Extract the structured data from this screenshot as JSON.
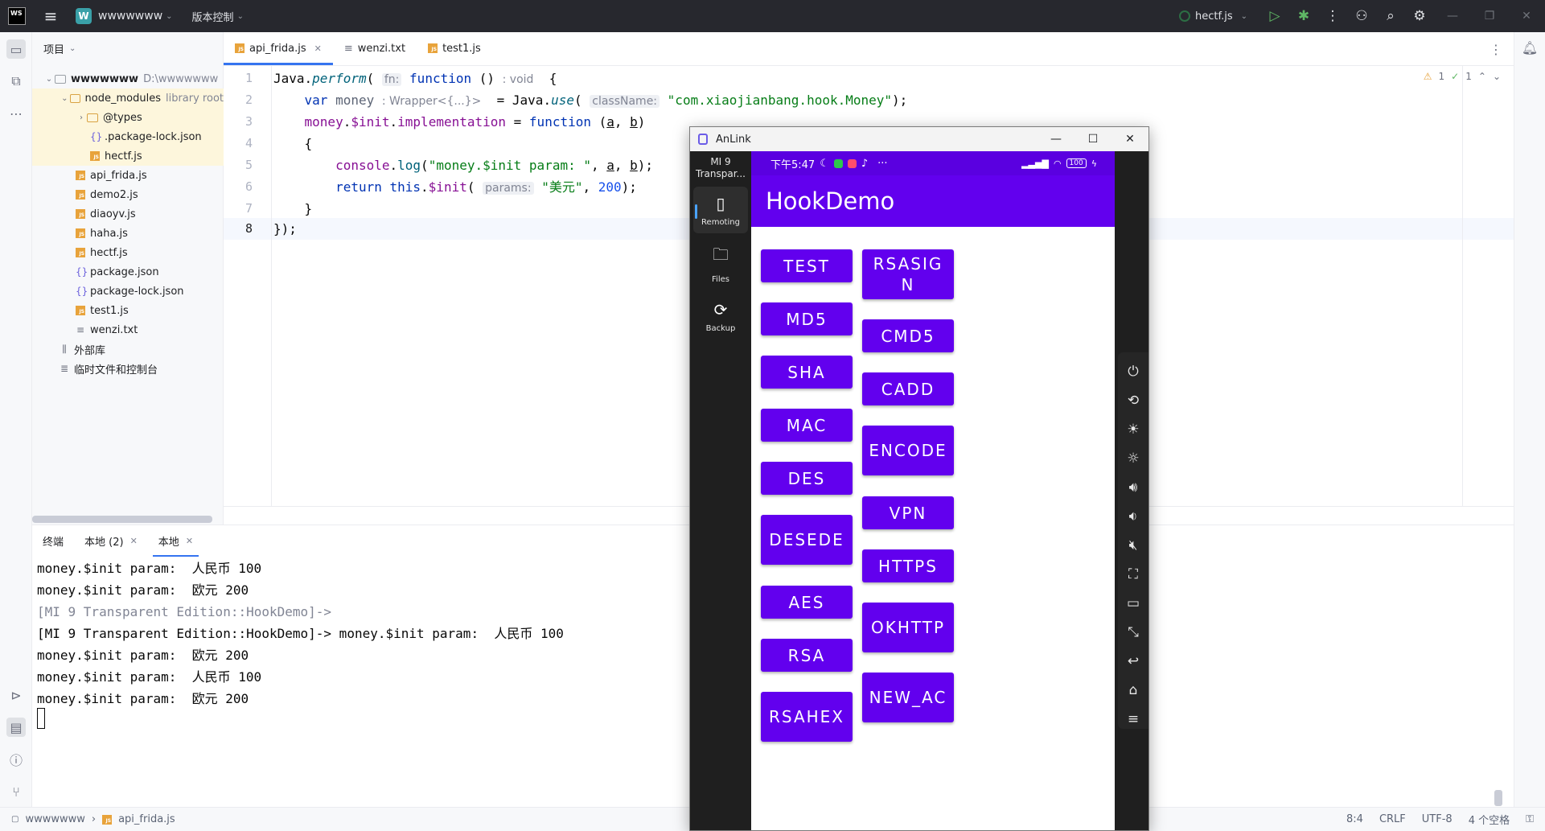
{
  "titlebar": {
    "logo": "WS",
    "project_badge": "W",
    "project_name": "wwwwwww",
    "vcs_label": "版本控制",
    "run_config": "hectf.js"
  },
  "project_panel": {
    "header": "项目",
    "tree": [
      {
        "label": "wwwwwww",
        "extra": "D:\\wwwwwww",
        "type": "folder"
      },
      {
        "label": "node_modules",
        "extra": "library root",
        "type": "folder"
      },
      {
        "label": "@types",
        "extra": "",
        "type": "folder"
      },
      {
        "label": ".package-lock.json",
        "extra": "",
        "type": "json"
      },
      {
        "label": "hectf.js",
        "extra": "",
        "type": "js"
      },
      {
        "label": "api_frida.js",
        "extra": "",
        "type": "js"
      },
      {
        "label": "demo2.js",
        "extra": "",
        "type": "js"
      },
      {
        "label": "diaoyv.js",
        "extra": "",
        "type": "js"
      },
      {
        "label": "haha.js",
        "extra": "",
        "type": "js"
      },
      {
        "label": "hectf.js",
        "extra": "",
        "type": "js"
      },
      {
        "label": "package.json",
        "extra": "",
        "type": "json"
      },
      {
        "label": "package-lock.json",
        "extra": "",
        "type": "json"
      },
      {
        "label": "test1.js",
        "extra": "",
        "type": "js"
      },
      {
        "label": "wenzi.txt",
        "extra": "",
        "type": "txt"
      },
      {
        "label": "外部库",
        "extra": "",
        "type": "lib"
      },
      {
        "label": "临时文件和控制台",
        "extra": "",
        "type": "scratch"
      }
    ]
  },
  "editor_tabs": [
    {
      "label": "api_frida.js",
      "active": true
    },
    {
      "label": "wenzi.txt",
      "active": false
    },
    {
      "label": "test1.js",
      "active": false
    }
  ],
  "editor": {
    "line_numbers": [
      "1",
      "2",
      "3",
      "4",
      "5",
      "6",
      "7",
      "8"
    ],
    "inspections": {
      "warnings": "1",
      "ok": "1"
    },
    "tokens": {
      "java": "Java",
      "perform": "perform",
      "hint_fn": "fn:",
      "function": "function",
      "hint_void": ": void",
      "var": "var",
      "money": "money",
      "hint_wrapper": ": Wrapper<{...}>",
      "use": "use",
      "hint_classname": "className:",
      "class_string": "\"com.xiaojianbang.hook.Money\"",
      "init": "$init",
      "implementation": "implementation",
      "console": "console",
      "log": "log",
      "log_string": "\"money.$init param: \"",
      "return": "return",
      "this": "this",
      "hint_params": "params:",
      "euro_string": "\"美元\"",
      "num_200": "200",
      "a": "a",
      "b": "b"
    }
  },
  "terminal": {
    "tabs": [
      "终端",
      "本地 (2)",
      "本地"
    ],
    "lines": [
      "money.$init param:  人民币 100",
      "money.$init param:  欧元 200",
      "[MI 9 Transparent Edition::HookDemo]->",
      "[MI 9 Transparent Edition::HookDemo]-> money.$init param:  人民币 100",
      "money.$init param:  欧元 200",
      "money.$init param:  人民币 100",
      "money.$init param:  欧元 200"
    ]
  },
  "statusbar": {
    "project": "wwwwwww",
    "file": "api_frida.js",
    "position": "8:4",
    "line_ending": "CRLF",
    "encoding": "UTF-8",
    "indent": "4 个空格"
  },
  "anlink": {
    "title": "AnLink",
    "device_line1": "MI 9",
    "device_line2": "Transpar...",
    "sidebar": [
      {
        "label": "Remoting",
        "active": true
      },
      {
        "label": "Files",
        "active": false
      },
      {
        "label": "Backup",
        "active": false
      }
    ],
    "phone": {
      "time": "下午5:47",
      "battery": "100",
      "app_title": "HookDemo",
      "left_buttons": [
        "TEST",
        "MD5",
        "SHA",
        "MAC",
        "DES",
        "DESEDE",
        "AES",
        "RSA",
        "RSAHEX"
      ],
      "right_buttons": [
        "RSASIGN",
        "CMD5",
        "CADD",
        "ENCODE",
        "VPN",
        "HTTPS",
        "OKHTTP",
        "NEW_AC"
      ]
    }
  }
}
